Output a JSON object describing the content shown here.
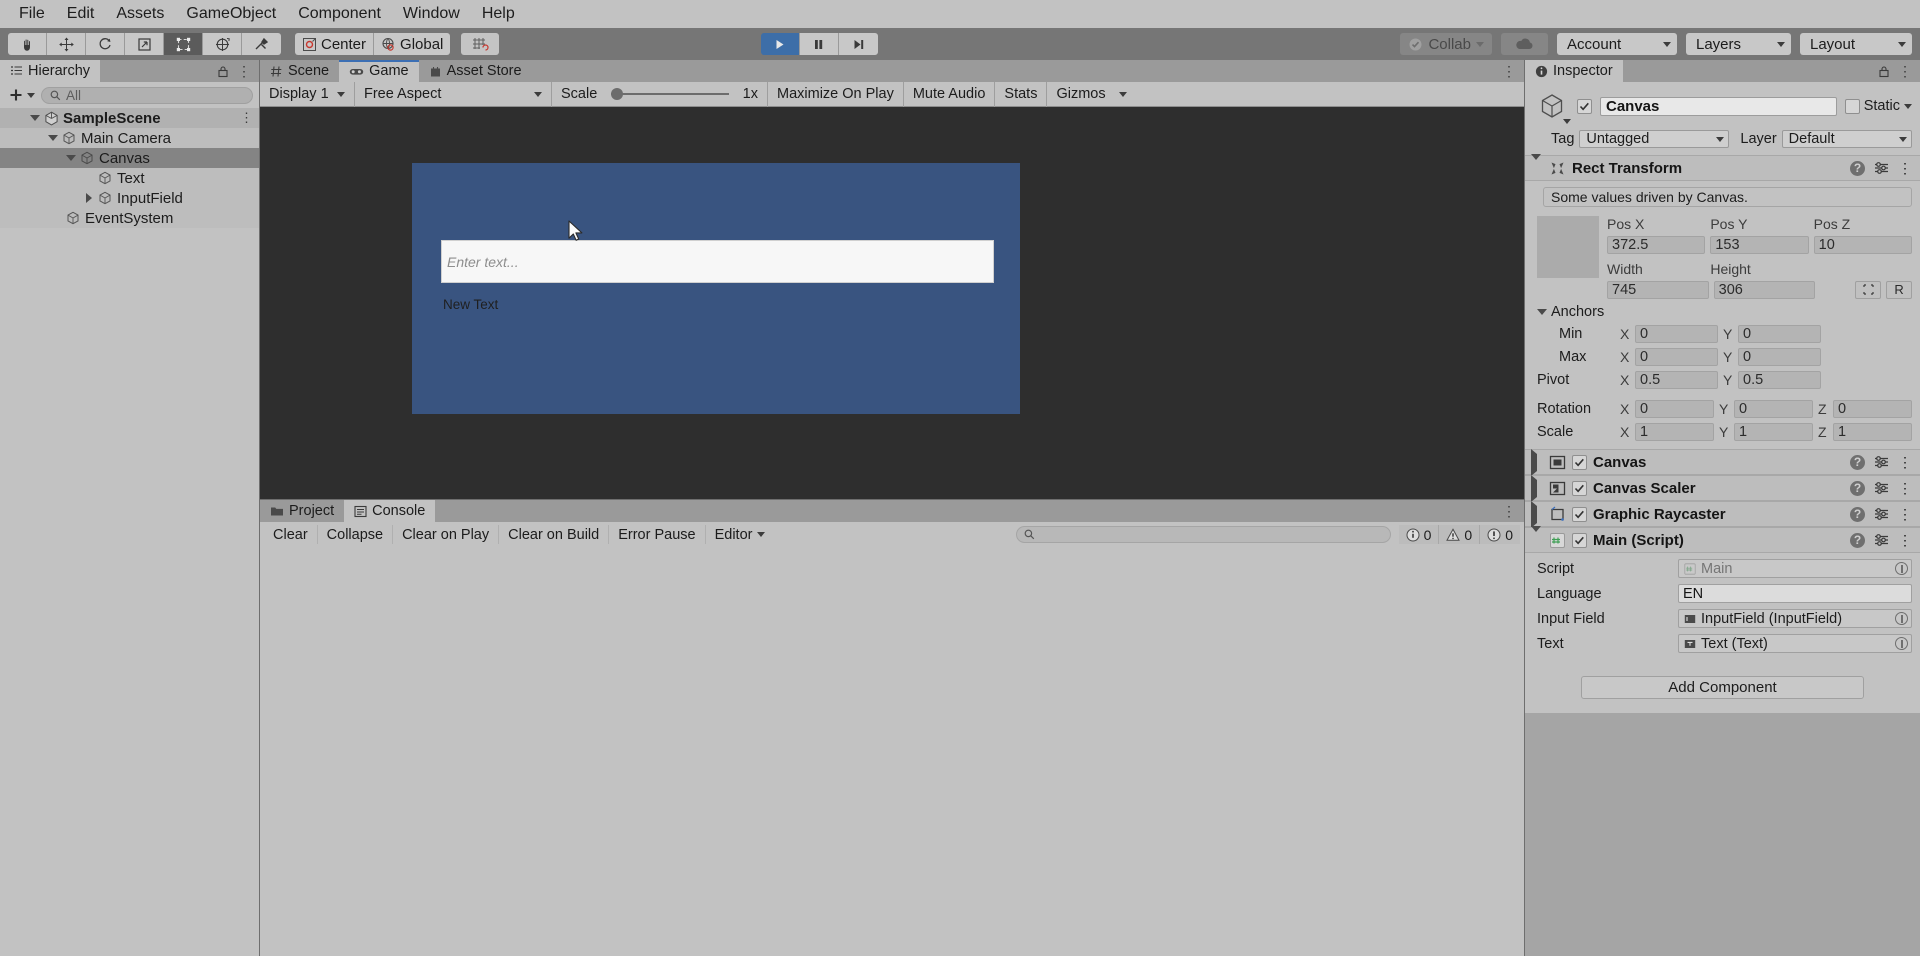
{
  "menubar": {
    "items": [
      "File",
      "Edit",
      "Assets",
      "GameObject",
      "Component",
      "Window",
      "Help"
    ]
  },
  "toolbar": {
    "tools": [
      {
        "name": "hand-tool",
        "icon": "hand-icon",
        "active": false
      },
      {
        "name": "move-tool",
        "icon": "move-icon",
        "active": false
      },
      {
        "name": "rotate-tool",
        "icon": "rotate-icon",
        "active": false
      },
      {
        "name": "scale-tool",
        "icon": "scale-icon",
        "active": false
      },
      {
        "name": "rect-tool",
        "icon": "rect-transform-icon",
        "active": true
      },
      {
        "name": "transform-tool",
        "icon": "transform-icon",
        "active": false
      },
      {
        "name": "custom-tool",
        "icon": "wrench-icon",
        "active": false
      }
    ],
    "pivot_label": "Center",
    "space_label": "Global",
    "grid_label": "",
    "play_label": "",
    "pause_label": "",
    "step_label": "",
    "collab_label": "Collab",
    "cloud_label": "",
    "account_label": "Account",
    "layers_label": "Layers",
    "layout_label": "Layout"
  },
  "hierarchy": {
    "tab_label": "Hierarchy",
    "add_label": "+",
    "search_placeholder": "All",
    "tree": [
      {
        "label": "SampleScene",
        "depth": 0,
        "expanded": true,
        "bold": true,
        "icon": "unity-scene-icon",
        "selected_scene": true,
        "has_kebab": true
      },
      {
        "label": "Main Camera",
        "depth": 1,
        "expanded": true,
        "bold": false,
        "icon": "gameobject-icon",
        "selected_scene": false,
        "has_kebab": false
      },
      {
        "label": "Canvas",
        "depth": 2,
        "expanded": true,
        "bold": false,
        "icon": "gameobject-icon",
        "selected": true,
        "has_kebab": false
      },
      {
        "label": "Text",
        "depth": 3,
        "expanded": null,
        "bold": false,
        "icon": "gameobject-icon",
        "has_kebab": false
      },
      {
        "label": "InputField",
        "depth": 3,
        "expanded": false,
        "bold": false,
        "icon": "gameobject-icon",
        "has_kebab": false
      },
      {
        "label": "EventSystem",
        "depth": 1,
        "expanded": null,
        "bold": false,
        "icon": "gameobject-icon",
        "has_kebab": false
      }
    ]
  },
  "center_tabs": [
    {
      "label": "Scene",
      "icon": "scene-grid-icon",
      "selected": false
    },
    {
      "label": "Game",
      "icon": "gamepad-icon",
      "selected": true
    },
    {
      "label": "Asset Store",
      "icon": "store-bag-icon",
      "selected": false
    }
  ],
  "game_toolbar": {
    "display": "Display 1",
    "aspect": "Free Aspect",
    "scale_label": "Scale",
    "scale_value": "1x",
    "maximize_label": "Maximize On Play",
    "mute_label": "Mute Audio",
    "stats_label": "Stats",
    "gizmos_label": "Gizmos"
  },
  "game_view": {
    "input_placeholder": "Enter text...",
    "output_text": "New Text"
  },
  "bottom_tabs": [
    {
      "label": "Project",
      "icon": "folder-icon",
      "selected": false
    },
    {
      "label": "Console",
      "icon": "console-icon",
      "selected": true
    }
  ],
  "console_toolbar": {
    "clear": "Clear",
    "collapse": "Collapse",
    "clear_on_play": "Clear on Play",
    "clear_on_build": "Clear on Build",
    "error_pause": "Error Pause",
    "editor": "Editor",
    "search_placeholder": "",
    "log_count": "0",
    "warn_count": "0",
    "error_count": "0"
  },
  "inspector": {
    "tab_label": "Inspector",
    "object_name": "Canvas",
    "enabled": true,
    "static_label": "Static",
    "tag_label": "Tag",
    "tag_value": "Untagged",
    "layer_label": "Layer",
    "layer_value": "Default",
    "rect_transform": {
      "title": "Rect Transform",
      "info": "Some values driven by Canvas.",
      "headers": [
        "Pos X",
        "Pos Y",
        "Pos Z"
      ],
      "pos": [
        "372.5",
        "153",
        "10"
      ],
      "size_headers": [
        "Width",
        "Height"
      ],
      "size": [
        "745",
        "306"
      ],
      "blueprint_label": "",
      "raw_label": "R",
      "anchors_label": "Anchors",
      "min_label": "Min",
      "min": {
        "x": "0",
        "y": "0"
      },
      "max_label": "Max",
      "max": {
        "x": "0",
        "y": "0"
      },
      "pivot_label": "Pivot",
      "pivot": {
        "x": "0.5",
        "y": "0.5"
      },
      "rotation_label": "Rotation",
      "rotation": {
        "x": "0",
        "y": "0",
        "z": "0"
      },
      "scale_label": "Scale",
      "scale": {
        "x": "1",
        "y": "1",
        "z": "1"
      }
    },
    "components": [
      {
        "title": "Canvas",
        "icon": "canvas-icon",
        "expanded": false,
        "enabled": true
      },
      {
        "title": "Canvas Scaler",
        "icon": "canvas-scaler-icon",
        "expanded": false,
        "enabled": true
      },
      {
        "title": "Graphic Raycaster",
        "icon": "graphic-raycaster-icon",
        "expanded": false,
        "enabled": true
      }
    ],
    "script_component": {
      "title": "Main (Script)",
      "icon": "cs-script-icon",
      "expanded": true,
      "enabled": true,
      "fields": [
        {
          "label": "Script",
          "value": "Main",
          "icon": "cs-script-icon",
          "kind": "object",
          "disabled": true
        },
        {
          "label": "Language",
          "value": "EN",
          "kind": "text"
        },
        {
          "label": "Input Field",
          "value": "InputField (InputField)",
          "icon": "inputfield-icon",
          "kind": "object"
        },
        {
          "label": "Text",
          "value": "Text (Text)",
          "icon": "text-icon",
          "kind": "object"
        }
      ]
    },
    "add_component_label": "Add Component"
  },
  "colors": {
    "canvas_blue": "#395480",
    "game_bg": "#2e2e2e",
    "panel_bg": "#c2c2c2",
    "toolbar_bg": "#767676",
    "play_active": "#3d6ea8",
    "tab_accent": "#3c6fb4"
  }
}
